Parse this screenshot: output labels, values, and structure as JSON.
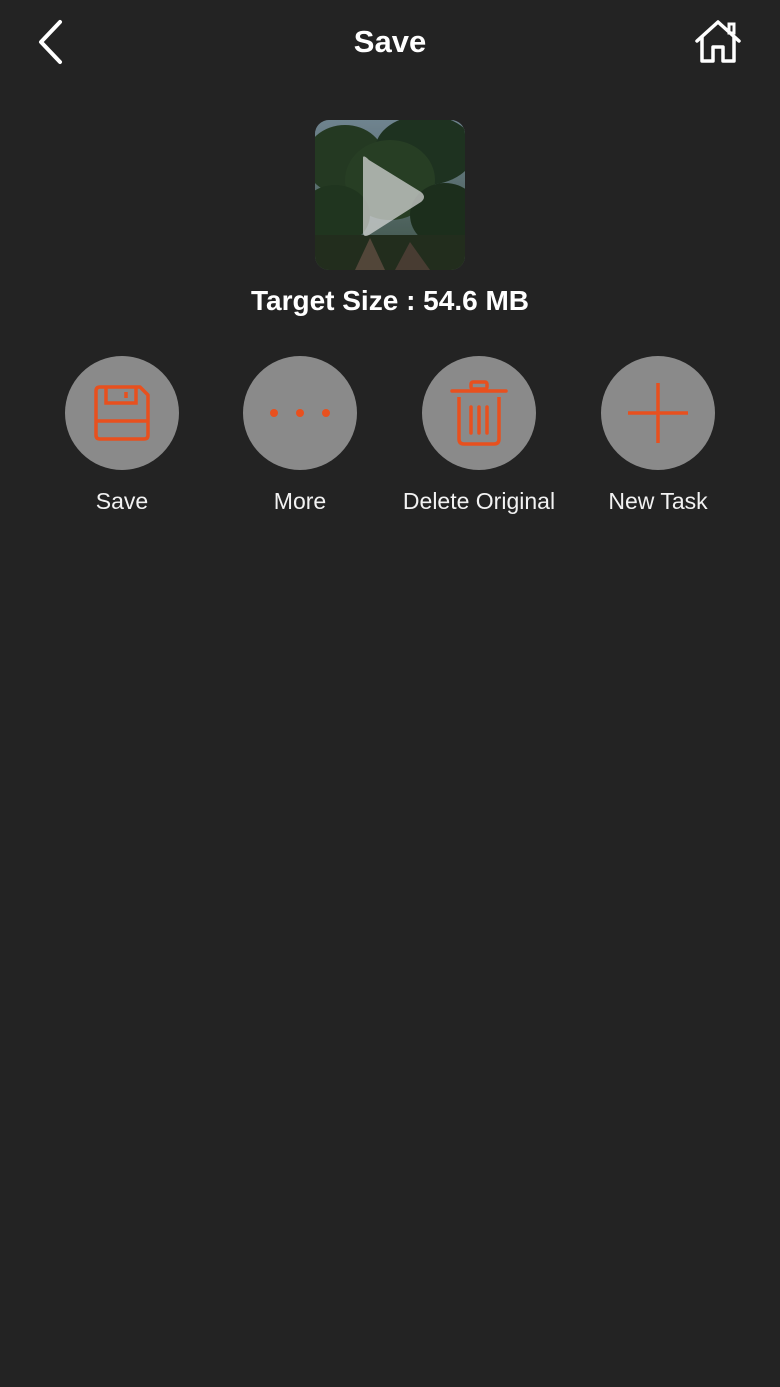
{
  "nav": {
    "title": "Save",
    "back_icon": "chevron-left-icon",
    "home_icon": "home-icon"
  },
  "preview": {
    "play_icon": "play-icon",
    "target_size_text": "Target Size : 54.6 MB"
  },
  "actions": [
    {
      "label": "Save",
      "icon": "floppy-disk-icon"
    },
    {
      "label": "More",
      "icon": "more-dots-icon"
    },
    {
      "label": "Delete Original",
      "icon": "trash-icon"
    },
    {
      "label": "New Task",
      "icon": "plus-icon"
    }
  ],
  "colors": {
    "background": "#232323",
    "accent": "#e8501e",
    "button_circle": "#8a8a8a",
    "text": "#ffffff"
  }
}
